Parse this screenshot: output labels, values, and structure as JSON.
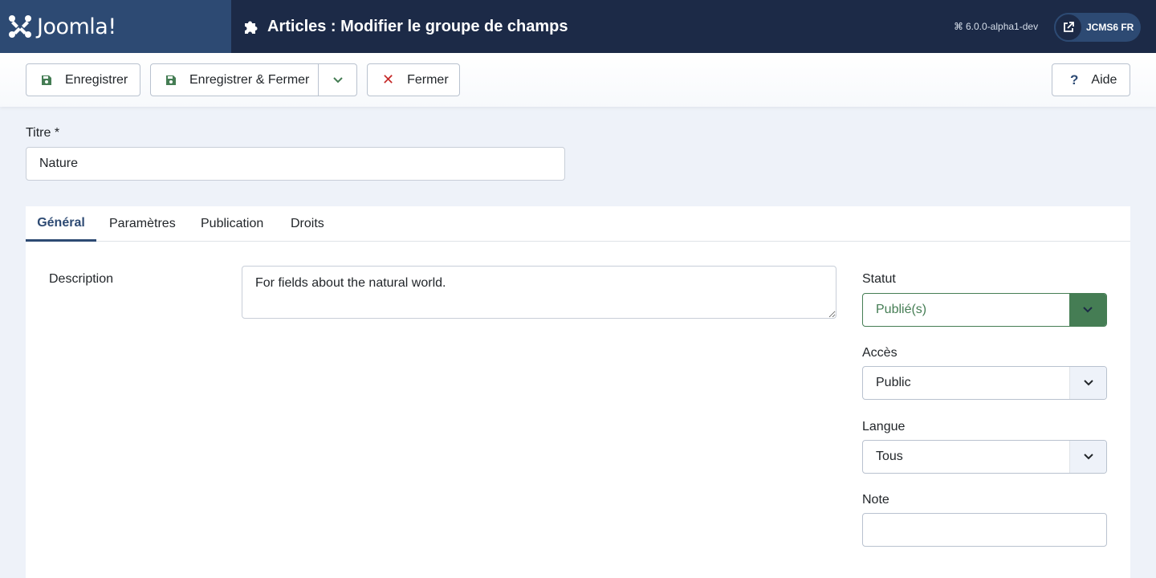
{
  "header": {
    "brand": "Joomla!",
    "title": "Articles : Modifier le groupe de champs",
    "version": "6.0.0-alpha1-dev",
    "site_label": "JCMS6 FR"
  },
  "toolbar": {
    "save_label": "Enregistrer",
    "save_close_label": "Enregistrer & Fermer",
    "close_label": "Fermer",
    "help_label": "Aide"
  },
  "form": {
    "title_label": "Titre *",
    "title_value": "Nature"
  },
  "tabs": [
    {
      "label": "Général",
      "active": true
    },
    {
      "label": "Paramètres",
      "active": false
    },
    {
      "label": "Publication",
      "active": false
    },
    {
      "label": "Droits",
      "active": false
    }
  ],
  "general": {
    "description_label": "Description",
    "description_value": "For fields about the natural world.",
    "status_label": "Statut",
    "status_value": "Publié(s)",
    "access_label": "Accès",
    "access_value": "Public",
    "language_label": "Langue",
    "language_value": "Tous",
    "note_label": "Note",
    "note_value": ""
  },
  "colors": {
    "header_bg": "#1c2a47",
    "brand_bg": "#2d4a73",
    "published_green": "#457d54",
    "close_red": "#c52827"
  }
}
